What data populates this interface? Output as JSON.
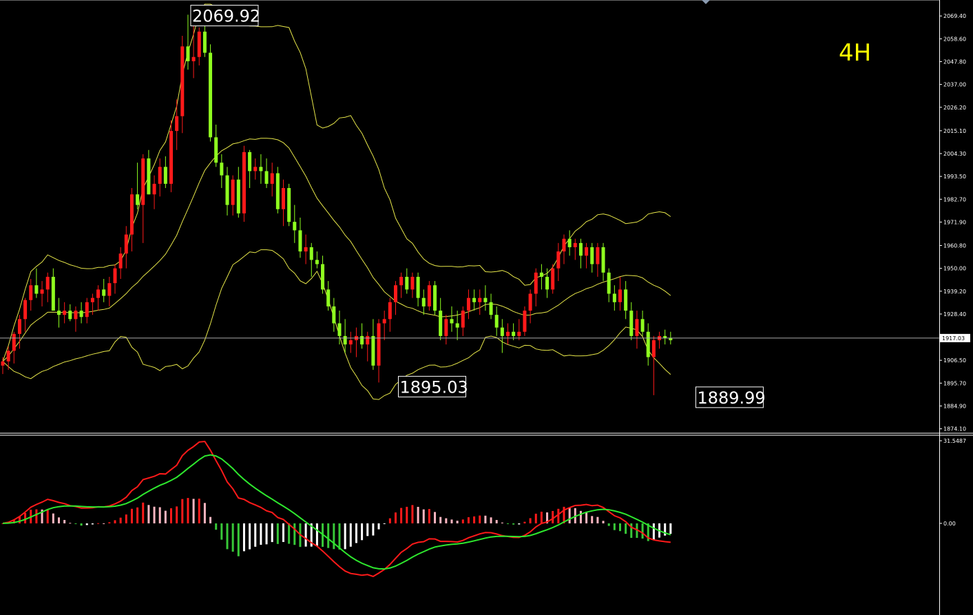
{
  "chart_data": {
    "type": "candlestick",
    "timeframe_label": "4H",
    "colors": {
      "background": "#000000",
      "bull_candle": "#ff1a1a",
      "bear_candle": "#8fff1f",
      "bollinger": "#e8e84a",
      "macd_line": "#ff1a1a",
      "signal_line": "#2ee82e",
      "hist_pos_rising": "#ff1a1a",
      "hist_pos_falling": "#ffb6c1",
      "hist_neg_falling": "#38c838",
      "hist_neg_rising": "#ffffff",
      "axis_text": "#ffffff",
      "current_price_line": "#aaaaaa"
    },
    "price_axis": {
      "ticks": [
        "2069.40",
        "2058.60",
        "2047.80",
        "2037.00",
        "2026.20",
        "2015.10",
        "2004.30",
        "1993.50",
        "1982.70",
        "1971.90",
        "1960.80",
        "1950.00",
        "1939.20",
        "1928.40",
        "1917.03",
        "1906.50",
        "1895.70",
        "1884.90",
        "1874.10"
      ],
      "current_price": "1917.03",
      "ylim": [
        1873,
        2075
      ]
    },
    "macd_axis": {
      "ticks": [
        "31.5487",
        "0.00"
      ],
      "ylim": [
        -35.0,
        31.5487
      ]
    },
    "callouts": [
      {
        "text": "2069.92",
        "price": 2069.92,
        "index": 33
      },
      {
        "text": "1895.03",
        "price": 1895.03,
        "index": 70
      },
      {
        "text": "1889.99",
        "price": 1889.99,
        "index": 123
      }
    ],
    "candles": [
      [
        1904,
        1908,
        1900,
        1906
      ],
      [
        1906,
        1913,
        1902,
        1911
      ],
      [
        1911,
        1920,
        1905,
        1919
      ],
      [
        1919,
        1928,
        1912,
        1926
      ],
      [
        1926,
        1936,
        1920,
        1935
      ],
      [
        1935,
        1945,
        1930,
        1942
      ],
      [
        1942,
        1950,
        1936,
        1938
      ],
      [
        1938,
        1944,
        1932,
        1940
      ],
      [
        1940,
        1948,
        1934,
        1946
      ],
      [
        1946,
        1950,
        1938,
        1930
      ],
      [
        1930,
        1936,
        1922,
        1928
      ],
      [
        1928,
        1934,
        1924,
        1930
      ],
      [
        1930,
        1933,
        1925,
        1926
      ],
      [
        1926,
        1932,
        1920,
        1930
      ],
      [
        1930,
        1934,
        1924,
        1927
      ],
      [
        1927,
        1936,
        1924,
        1934
      ],
      [
        1934,
        1938,
        1928,
        1936
      ],
      [
        1936,
        1942,
        1930,
        1940
      ],
      [
        1940,
        1945,
        1934,
        1937
      ],
      [
        1937,
        1946,
        1932,
        1943
      ],
      [
        1943,
        1952,
        1938,
        1950
      ],
      [
        1950,
        1960,
        1945,
        1957
      ],
      [
        1957,
        1970,
        1950,
        1966
      ],
      [
        1966,
        1988,
        1958,
        1985
      ],
      [
        1985,
        2000,
        1978,
        1980
      ],
      [
        1980,
        2004,
        1962,
        2002
      ],
      [
        2002,
        2006,
        1985,
        1985
      ],
      [
        1985,
        1994,
        1978,
        1990
      ],
      [
        1990,
        2002,
        1984,
        1998
      ],
      [
        1998,
        2003,
        1988,
        1990
      ],
      [
        1990,
        2020,
        1986,
        2015
      ],
      [
        2015,
        2030,
        2006,
        2022
      ],
      [
        2022,
        2060,
        2014,
        2055
      ],
      [
        2055,
        2070,
        2044,
        2048
      ],
      [
        2048,
        2066,
        2040,
        2050
      ],
      [
        2050,
        2064,
        2046,
        2062
      ],
      [
        2062,
        2068,
        2050,
        2052
      ],
      [
        2052,
        2056,
        2010,
        2012
      ],
      [
        2012,
        2018,
        1998,
        2000
      ],
      [
        2000,
        2004,
        1988,
        1994
      ],
      [
        1994,
        1998,
        1975,
        1980
      ],
      [
        1980,
        1994,
        1975,
        1992
      ],
      [
        1992,
        1998,
        1974,
        1976
      ],
      [
        1976,
        2008,
        1972,
        2005
      ],
      [
        2005,
        2006,
        1988,
        1996
      ],
      [
        1996,
        2002,
        1992,
        1998
      ],
      [
        1998,
        2004,
        1990,
        1996
      ],
      [
        1996,
        2002,
        1988,
        1990
      ],
      [
        1990,
        2000,
        1984,
        1995
      ],
      [
        1995,
        1998,
        1976,
        1978
      ],
      [
        1978,
        1992,
        1970,
        1988
      ],
      [
        1988,
        1990,
        1970,
        1972
      ],
      [
        1972,
        1980,
        1962,
        1968
      ],
      [
        1968,
        1974,
        1955,
        1958
      ],
      [
        1958,
        1966,
        1952,
        1960
      ],
      [
        1960,
        1962,
        1946,
        1954
      ],
      [
        1954,
        1958,
        1950,
        1952
      ],
      [
        1952,
        1956,
        1938,
        1940
      ],
      [
        1940,
        1944,
        1930,
        1932
      ],
      [
        1932,
        1936,
        1920,
        1924
      ],
      [
        1924,
        1930,
        1914,
        1918
      ],
      [
        1918,
        1926,
        1910,
        1914
      ],
      [
        1914,
        1920,
        1910,
        1916
      ],
      [
        1916,
        1922,
        1908,
        1918
      ],
      [
        1918,
        1924,
        1912,
        1914
      ],
      [
        1914,
        1920,
        1906,
        1918
      ],
      [
        1918,
        1926,
        1902,
        1904
      ],
      [
        1904,
        1926,
        1896,
        1924
      ],
      [
        1924,
        1930,
        1916,
        1926
      ],
      [
        1926,
        1936,
        1920,
        1934
      ],
      [
        1934,
        1944,
        1928,
        1942
      ],
      [
        1942,
        1948,
        1936,
        1946
      ],
      [
        1946,
        1950,
        1938,
        1940
      ],
      [
        1940,
        1948,
        1936,
        1946
      ],
      [
        1946,
        1948,
        1932,
        1936
      ],
      [
        1936,
        1940,
        1928,
        1932
      ],
      [
        1932,
        1944,
        1930,
        1942
      ],
      [
        1942,
        1944,
        1928,
        1930
      ],
      [
        1930,
        1936,
        1916,
        1918
      ],
      [
        1918,
        1928,
        1914,
        1926
      ],
      [
        1926,
        1932,
        1920,
        1924
      ],
      [
        1924,
        1930,
        1916,
        1922
      ],
      [
        1922,
        1932,
        1918,
        1930
      ],
      [
        1930,
        1940,
        1926,
        1936
      ],
      [
        1936,
        1940,
        1930,
        1934
      ],
      [
        1934,
        1940,
        1928,
        1936
      ],
      [
        1936,
        1942,
        1930,
        1934
      ],
      [
        1934,
        1938,
        1926,
        1928
      ],
      [
        1928,
        1932,
        1918,
        1922
      ],
      [
        1922,
        1926,
        1910,
        1918
      ],
      [
        1918,
        1924,
        1914,
        1920
      ],
      [
        1920,
        1924,
        1916,
        1918
      ],
      [
        1918,
        1926,
        1916,
        1920
      ],
      [
        1920,
        1932,
        1918,
        1930
      ],
      [
        1930,
        1940,
        1924,
        1938
      ],
      [
        1938,
        1950,
        1932,
        1948
      ],
      [
        1948,
        1952,
        1940,
        1946
      ],
      [
        1946,
        1950,
        1936,
        1940
      ],
      [
        1940,
        1952,
        1938,
        1950
      ],
      [
        1950,
        1962,
        1944,
        1958
      ],
      [
        1958,
        1966,
        1952,
        1964
      ],
      [
        1964,
        1968,
        1956,
        1960
      ],
      [
        1960,
        1964,
        1954,
        1962
      ],
      [
        1962,
        1964,
        1950,
        1956
      ],
      [
        1956,
        1962,
        1950,
        1960
      ],
      [
        1960,
        1962,
        1948,
        1952
      ],
      [
        1952,
        1962,
        1946,
        1960
      ],
      [
        1960,
        1962,
        1944,
        1948
      ],
      [
        1948,
        1950,
        1934,
        1938
      ],
      [
        1938,
        1942,
        1930,
        1934
      ],
      [
        1934,
        1946,
        1930,
        1940
      ],
      [
        1940,
        1944,
        1926,
        1930
      ],
      [
        1930,
        1934,
        1916,
        1918
      ],
      [
        1918,
        1930,
        1912,
        1926
      ],
      [
        1926,
        1930,
        1918,
        1920
      ],
      [
        1920,
        1924,
        1904,
        1908
      ],
      [
        1908,
        1918,
        1890,
        1916
      ],
      [
        1916,
        1920,
        1912,
        1918
      ],
      [
        1918,
        1921,
        1914,
        1917
      ],
      [
        1917,
        1920,
        1914,
        1916
      ]
    ],
    "note_omitted": ""
  }
}
